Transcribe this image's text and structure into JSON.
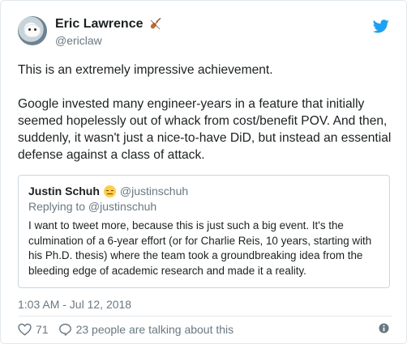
{
  "author": {
    "display_name": "Eric Lawrence",
    "handle": "@ericlaw",
    "emoji_icon": "violin-icon",
    "avatar_icon": "dog-avatar"
  },
  "tweet": {
    "paragraphs": [
      "This is an extremely impressive achievement.",
      "Google invested many engineer-years in a feature that initially seemed hopelessly out of whack from cost/benefit POV. And then, suddenly, it wasn't just a nice-to-have DiD, but instead an essential defense against a class of attack."
    ]
  },
  "quoted": {
    "display_name": "Justin Schuh",
    "emoji_icon": "expressionless-face-icon",
    "handle": "@justinschuh",
    "replying_to": "Replying to @justinschuh",
    "text": "I want to tweet more, because this is just such a big event. It's the culmination of a 6-year effort (or for Charlie Reis, 10 years, starting with his Ph.D. thesis) where the team took a groundbreaking idea from the bleeding edge of academic research and made it a reality."
  },
  "timestamp": "1:03 AM - Jul 12, 2018",
  "actions": {
    "likes": "71",
    "talking": "23 people are talking about this"
  },
  "colors": {
    "twitter_blue": "#1da1f2",
    "secondary_text": "#697882",
    "border": "#e1e8ed"
  }
}
